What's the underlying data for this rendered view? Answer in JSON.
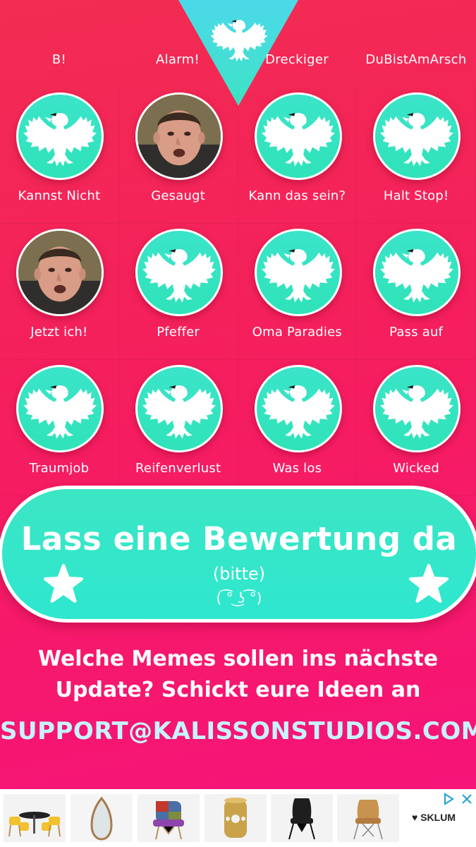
{
  "top_row": [
    {
      "label": "B!"
    },
    {
      "label": "Alarm!"
    },
    {
      "label": "Dreckiger"
    },
    {
      "label": "DuBistAmArsch"
    }
  ],
  "sounds": [
    {
      "label": "Kannst Nicht",
      "image": "eagle-icon"
    },
    {
      "label": "Gesaugt",
      "image": "man-photo"
    },
    {
      "label": "Kann das sein?",
      "image": "eagle-icon"
    },
    {
      "label": "Halt Stop!",
      "image": "eagle-icon"
    },
    {
      "label": "Jetzt ich!",
      "image": "man-photo"
    },
    {
      "label": "Pfeffer",
      "image": "eagle-icon"
    },
    {
      "label": "Oma Paradies",
      "image": "eagle-icon"
    },
    {
      "label": "Pass auf",
      "image": "eagle-icon"
    },
    {
      "label": "Traumjob",
      "image": "eagle-icon"
    },
    {
      "label": "Reifenverlust",
      "image": "eagle-icon"
    },
    {
      "label": "Was los",
      "image": "eagle-icon"
    },
    {
      "label": "Wicked",
      "image": "eagle-icon"
    }
  ],
  "rating": {
    "title": "Lass eine Bewertung da",
    "subtitle": "(bitte)",
    "face": "( ͡° ͜ʖ ͡°)"
  },
  "info": {
    "line1": "Welche Memes sollen ins nächste",
    "line2": "Update? Schickt eure Ideen an",
    "email": "SUPPORT@KALISSONSTUDIOS.COM"
  },
  "ad": {
    "brand": "♥ SKLUM",
    "products": [
      "table-chairs",
      "mirror",
      "patchwork-chair",
      "gold-stool",
      "black-chair",
      "wood-chair"
    ]
  },
  "colors": {
    "background": "#f51e5e",
    "accent": "#3ce6c4",
    "text": "#ffffff",
    "email": "#c6f3ff"
  }
}
